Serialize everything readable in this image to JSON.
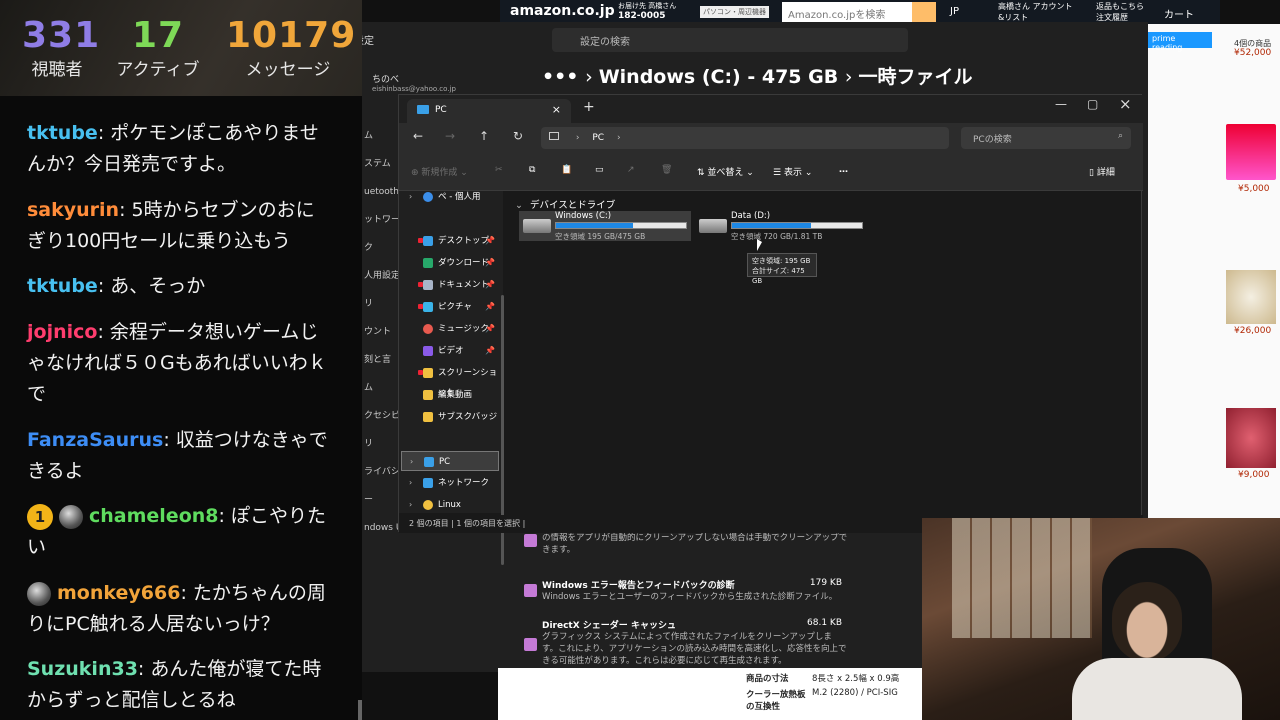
{
  "chat": {
    "stats": [
      {
        "value": "331",
        "label": "視聴者",
        "color": "#8f7de6"
      },
      {
        "value": "17",
        "label": "アクティブ",
        "color": "#7ed957"
      },
      {
        "value": "10179",
        "label": "メッセージ",
        "color": "#f0a63a"
      }
    ],
    "messages": [
      {
        "user": "tktube",
        "color": "#48c0f0",
        "text": "ポケモンぽこあやりませんか？今日発売ですよ。"
      },
      {
        "user": "sakyurin",
        "color": "#ff8c3a",
        "text": "5時からセブンのおにぎり100円セールに乗り込もう"
      },
      {
        "user": "tktube",
        "color": "#48c0f0",
        "text": "あ、そっか"
      },
      {
        "user": "jojnico",
        "color": "#ff3d6e",
        "text": "余程データ想いゲームじゃなければ５０Gもあればいいわｋで"
      },
      {
        "user": "FanzaSaurus",
        "color": "#3d8df5",
        "text": "収益つけなきゃできるよ"
      },
      {
        "user": "chameleon8",
        "color": "#5fdc5f",
        "text": "ぽこやりたい",
        "badge": "1"
      },
      {
        "user": "monkey666",
        "color": "#f2a43a",
        "text": "たかちゃんの周りにPC触れる人居ないっけ？"
      },
      {
        "user": "Suzukin33",
        "color": "#6fe0b0",
        "text": "あんた俺が寝てた時からずっと配信しとるね"
      }
    ]
  },
  "amazon": {
    "logo": "amazon.co.jp",
    "deliver": "お届け先 高橋さん",
    "postal": "182-0005",
    "category": "パソコン・周辺機器",
    "search_placeholder": "Amazon.co.jpを検索",
    "lang": "JP",
    "account": "高橋さん アカウント&リスト",
    "orders": "返品もこちら 注文履歴",
    "cart": "カート",
    "prime": "prime reading",
    "right_items": [
      "4個の商品",
      "¥52,000",
      "¥5,000",
      "¥26,000",
      "¥9,000"
    ]
  },
  "settings": {
    "title": "設定",
    "search_placeholder": "設定の検索",
    "user_name": "ちのべ",
    "user_email": "eishinbass@yahoo.co.jp",
    "crumb_drive": "Windows (C:) - 475 GB",
    "crumb_page": "一時ファイル",
    "left_items": [
      "ム",
      "ステム",
      "uetooth",
      "ットワーク",
      "人用設定",
      "リ",
      "ウント",
      "刻と言",
      "ム",
      "クセシビリ",
      "ライバシー",
      "ndows U"
    ],
    "items": [
      {
        "name": "",
        "size": "",
        "desc": "の情報をアプリが自動的にクリーンアップしない場合は手動でクリーンアップできます。"
      },
      {
        "name": "Windows エラー報告とフィードバックの診断",
        "size": "179 KB",
        "desc": "Windows エラーとユーザーのフィードバックから生成された診断ファイル。"
      },
      {
        "name": "DirectX シェーダー キャッシュ",
        "size": "68.1 KB",
        "desc": "グラフィックス システムによって作成されたファイルをクリーンアップします。これにより、アプリケーションの読み込み時間を高速化し、応答性を向上できる可能性があります。これらは必要に応じて再生成されます。"
      }
    ]
  },
  "product_table": [
    {
      "label": "商品の寸法",
      "value": "8長さ x 2.5幅 x 0.9高"
    },
    {
      "label": "クーラー放熱板の互換性",
      "value": "M.2 (2280) / PCI-SIG"
    }
  ],
  "explorer": {
    "tab_label": "PC",
    "address": "PC",
    "search_placeholder": "PCの検索",
    "commands": {
      "new": "新規作成",
      "sort": "並べ替え",
      "view": "表示",
      "more": "…",
      "details": "詳細"
    },
    "nav": [
      {
        "label": "ペ - 個人用",
        "icon_color": "#3b8eea"
      },
      {
        "label": "デスクトップ",
        "icon_color": "#3aa0e8"
      },
      {
        "label": "ダウンロード",
        "icon_color": "#27a86a"
      },
      {
        "label": "ドキュメント",
        "icon_color": "#a8b4c8"
      },
      {
        "label": "ピクチャ",
        "icon_color": "#3ab3e8"
      },
      {
        "label": "ミュージック",
        "icon_color": "#e85a4f"
      },
      {
        "label": "ビデオ",
        "icon_color": "#8a5ae8"
      },
      {
        "label": "スクリーンショット",
        "icon_color": "#f0c040"
      },
      {
        "label": "編集動画",
        "icon_color": "#f0c040"
      },
      {
        "label": "サブスクバッジ",
        "icon_color": "#f0c040"
      },
      {
        "label": "PC",
        "icon_color": "#3aa0e8"
      },
      {
        "label": "ネットワーク",
        "icon_color": "#3aa0e8"
      },
      {
        "label": "Linux",
        "icon_color": "#f0c040"
      }
    ],
    "group": "デバイスとドライブ",
    "drives": [
      {
        "name": "Windows (C:)",
        "free": "空き領域 195 GB/475 GB",
        "used_fraction": 0.59
      },
      {
        "name": "Data (D:)",
        "free": "空き領域 720 GB/1.81 TB",
        "used_fraction": 0.61
      }
    ],
    "tooltip": {
      "line1": "空き領域: 195 GB",
      "line2": "合計サイズ: 475 GB"
    },
    "status": "2 個の項目  |  1 個の項目を選択  |"
  }
}
